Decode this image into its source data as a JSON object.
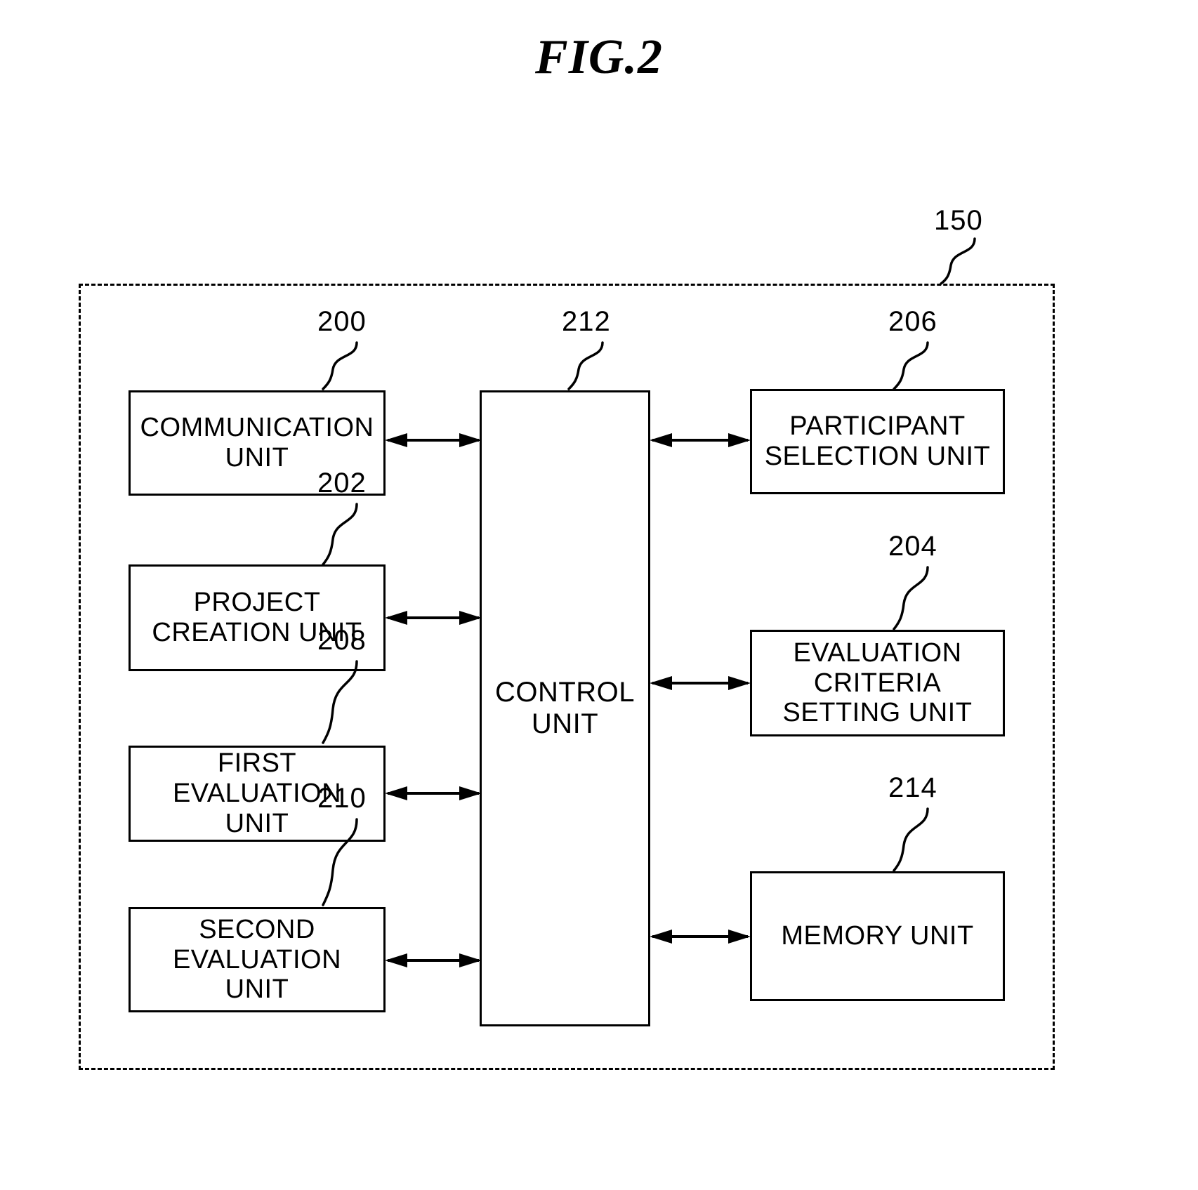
{
  "figure": {
    "title": "FIG.2",
    "enclosure_ref": "150"
  },
  "blocks": [
    {
      "id": "communication-unit",
      "label": "COMMUNICATION\nUNIT",
      "ref": "200"
    },
    {
      "id": "project-creation-unit",
      "label": "PROJECT\nCREATION UNIT",
      "ref": "202"
    },
    {
      "id": "first-evaluation-unit",
      "label": "FIRST\nEVALUATION\nUNIT",
      "ref": "208"
    },
    {
      "id": "second-evaluation-unit",
      "label": "SECOND\nEVALUATION\nUNIT",
      "ref": "210"
    },
    {
      "id": "control-unit",
      "label": "CONTROL\nUNIT",
      "ref": "212"
    },
    {
      "id": "participant-selection-unit",
      "label": "PARTICIPANT\nSELECTION UNIT",
      "ref": "206"
    },
    {
      "id": "evaluation-criteria-setting-unit",
      "label": "EVALUATION\nCRITERIA\nSETTING UNIT",
      "ref": "204"
    },
    {
      "id": "memory-unit",
      "label": "MEMORY UNIT",
      "ref": "214"
    }
  ],
  "connections": [
    {
      "from": "communication-unit",
      "to": "control-unit",
      "type": "bidirectional"
    },
    {
      "from": "project-creation-unit",
      "to": "control-unit",
      "type": "bidirectional"
    },
    {
      "from": "first-evaluation-unit",
      "to": "control-unit",
      "type": "bidirectional"
    },
    {
      "from": "second-evaluation-unit",
      "to": "control-unit",
      "type": "bidirectional"
    },
    {
      "from": "control-unit",
      "to": "participant-selection-unit",
      "type": "bidirectional"
    },
    {
      "from": "control-unit",
      "to": "evaluation-criteria-setting-unit",
      "type": "bidirectional"
    },
    {
      "from": "control-unit",
      "to": "memory-unit",
      "type": "bidirectional"
    }
  ],
  "colors": {
    "ink": "#000000",
    "paper": "#ffffff"
  }
}
